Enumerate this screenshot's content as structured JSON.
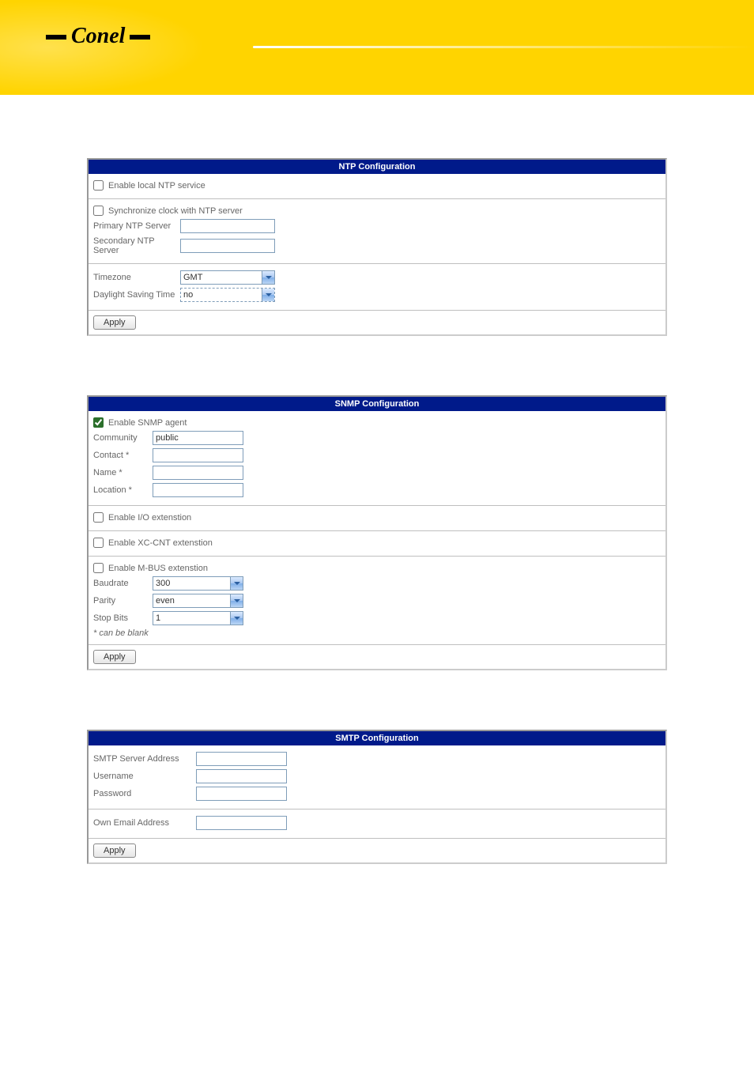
{
  "ntp": {
    "title": "NTP Configuration",
    "enable_local": "Enable local NTP service",
    "sync_ntp": "Synchronize clock with NTP server",
    "primary_label": "Primary NTP Server",
    "secondary_label": "Secondary NTP Server",
    "primary_value": "",
    "secondary_value": "",
    "timezone_label": "Timezone",
    "timezone_value": "GMT",
    "dst_label": "Daylight Saving Time",
    "dst_value": "no",
    "apply": "Apply"
  },
  "snmp": {
    "title": "SNMP Configuration",
    "enable_agent": "Enable SNMP agent",
    "community_label": "Community",
    "community_value": "public",
    "contact_label": "Contact *",
    "contact_value": "",
    "name_label": "Name *",
    "name_value": "",
    "location_label": "Location *",
    "location_value": "",
    "enable_io": "Enable I/O extenstion",
    "enable_xccnt": "Enable XC-CNT extenstion",
    "enable_mbus": "Enable M-BUS extenstion",
    "baudrate_label": "Baudrate",
    "baudrate_value": "300",
    "parity_label": "Parity",
    "parity_value": "even",
    "stopbits_label": "Stop Bits",
    "stopbits_value": "1",
    "note": "* can be blank",
    "apply": "Apply"
  },
  "smtp": {
    "title": "SMTP Configuration",
    "server_label": "SMTP Server Address",
    "server_value": "",
    "username_label": "Username",
    "username_value": "",
    "password_label": "Password",
    "password_value": "",
    "own_email_label": "Own Email Address",
    "own_email_value": "",
    "apply": "Apply"
  }
}
